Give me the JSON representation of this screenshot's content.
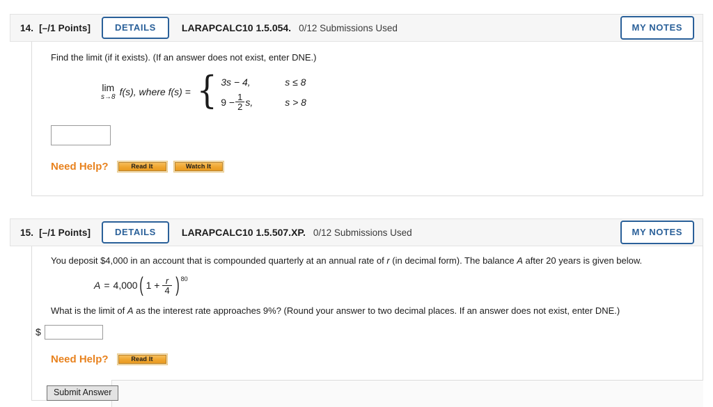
{
  "questions": [
    {
      "number": "14.",
      "points": "[–/1 Points]",
      "details_label": "DETAILS",
      "code": "LARAPCALC10 1.5.054.",
      "submissions": "0/12 Submissions Used",
      "notes_label": "MY NOTES",
      "prompt": "Find the limit (if it exists). (If an answer does not exist, enter DNE.)",
      "math": {
        "lim_main": "lim",
        "lim_sub": "s→8",
        "func": "f(s), where f(s) =",
        "case1_expr": "3s − 4,",
        "case1_cond": "s ≤ 8",
        "case2_lead": "9 −",
        "case2_num": "1",
        "case2_den": "2",
        "case2_tail": "s,",
        "case2_cond": "s > 8"
      },
      "answer_value": "",
      "need_help_label": "Need Help?",
      "help_buttons": [
        "Read It",
        "Watch It"
      ]
    },
    {
      "number": "15.",
      "points": "[–/1 Points]",
      "details_label": "DETAILS",
      "code": "LARAPCALC10 1.5.507.XP.",
      "submissions": "0/12 Submissions Used",
      "notes_label": "MY NOTES",
      "prompt_part1": "You deposit $4,000 in an account that is compounded quarterly at an annual rate of ",
      "prompt_var": "r",
      "prompt_part2": " (in decimal form). The balance ",
      "prompt_var2": "A",
      "prompt_part3": " after 20 years is given below.",
      "formula": {
        "lhs": "A",
        "eq": "=",
        "coef": "4,000",
        "open": "(",
        "one_plus": "1 +",
        "num": "r",
        "den": "4",
        "close": ")",
        "exp": "80"
      },
      "question_part1": "What is the limit of ",
      "question_var": "A",
      "question_part2": " as the interest rate approaches 9%? (Round your answer to two decimal places. If an answer does not exist, enter DNE.)",
      "dollar_sign": "$",
      "answer_value": "",
      "need_help_label": "Need Help?",
      "help_buttons": [
        "Read It"
      ],
      "submit_label": "Submit Answer"
    }
  ],
  "colors": {
    "accent_blue": "#2a6099",
    "help_orange": "#e8821e",
    "header_bg": "#f6f6f6"
  }
}
